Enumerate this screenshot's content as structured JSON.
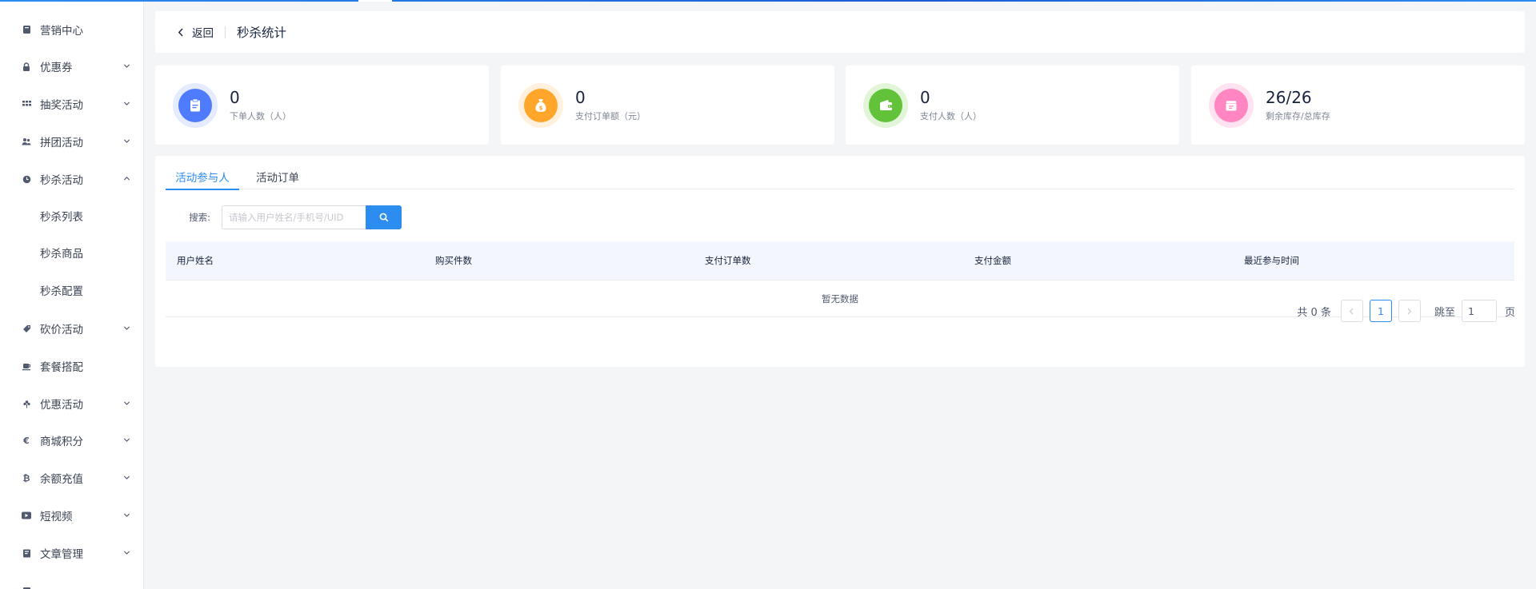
{
  "colors": {
    "accent": "#2d8cf0",
    "stat_blue": "#4f7cff",
    "stat_orange": "#ffa62b",
    "stat_green": "#62c33a",
    "stat_pink": "#ff86c2"
  },
  "sidebar": {
    "items": [
      {
        "label": "营销中心",
        "icon": "marketing-icon",
        "has_arrow": false
      },
      {
        "label": "优惠券",
        "icon": "lock-icon",
        "has_arrow": true,
        "arrow": "down"
      },
      {
        "label": "抽奖活动",
        "icon": "grid-icon",
        "has_arrow": true,
        "arrow": "down"
      },
      {
        "label": "拼团活动",
        "icon": "group-icon",
        "has_arrow": true,
        "arrow": "down"
      },
      {
        "label": "秒杀活动",
        "icon": "clock-icon",
        "has_arrow": true,
        "arrow": "up"
      },
      {
        "label": "秒杀列表",
        "sub": true
      },
      {
        "label": "秒杀商品",
        "sub": true
      },
      {
        "label": "秒杀配置",
        "sub": true
      },
      {
        "label": "砍价活动",
        "icon": "tag-icon",
        "has_arrow": true,
        "arrow": "down"
      },
      {
        "label": "套餐搭配",
        "icon": "cup-icon",
        "has_arrow": false
      },
      {
        "label": "优惠活动",
        "icon": "flower-icon",
        "has_arrow": true,
        "arrow": "down"
      },
      {
        "label": "商城积分",
        "icon": "euro-icon",
        "has_arrow": true,
        "arrow": "down"
      },
      {
        "label": "余额充值",
        "icon": "bitcoin-icon",
        "has_arrow": true,
        "arrow": "down"
      },
      {
        "label": "短视频",
        "icon": "video-icon",
        "has_arrow": true,
        "arrow": "down"
      },
      {
        "label": "文章管理",
        "icon": "book-icon",
        "has_arrow": true,
        "arrow": "down"
      }
    ]
  },
  "header": {
    "back_label": "返回",
    "title": "秒杀统计"
  },
  "stats": [
    {
      "value": "0",
      "label": "下单人数（人）",
      "icon": "clipboard-icon",
      "color": "blue"
    },
    {
      "value": "0",
      "label": "支付订单额（元）",
      "icon": "money-bag-icon",
      "color": "orange"
    },
    {
      "value": "0",
      "label": "支付人数（人）",
      "icon": "wallet-icon",
      "color": "green"
    },
    {
      "value": "26/26",
      "label": "剩余库存/总库存",
      "icon": "inventory-icon",
      "color": "pink"
    }
  ],
  "tabs": [
    {
      "label": "活动参与人",
      "active": true
    },
    {
      "label": "活动订单",
      "active": false
    }
  ],
  "search": {
    "label": "搜索:",
    "placeholder": "请输入用户姓名/手机号/UID"
  },
  "table": {
    "columns": [
      "用户姓名",
      "购买件数",
      "支付订单数",
      "支付金额",
      "最近参与时间"
    ],
    "empty_text": "暂无数据"
  },
  "pagination": {
    "total_text": "共 0 条",
    "current_page": "1",
    "jump_label": "跳至",
    "jump_value": "1",
    "page_unit": "页"
  }
}
